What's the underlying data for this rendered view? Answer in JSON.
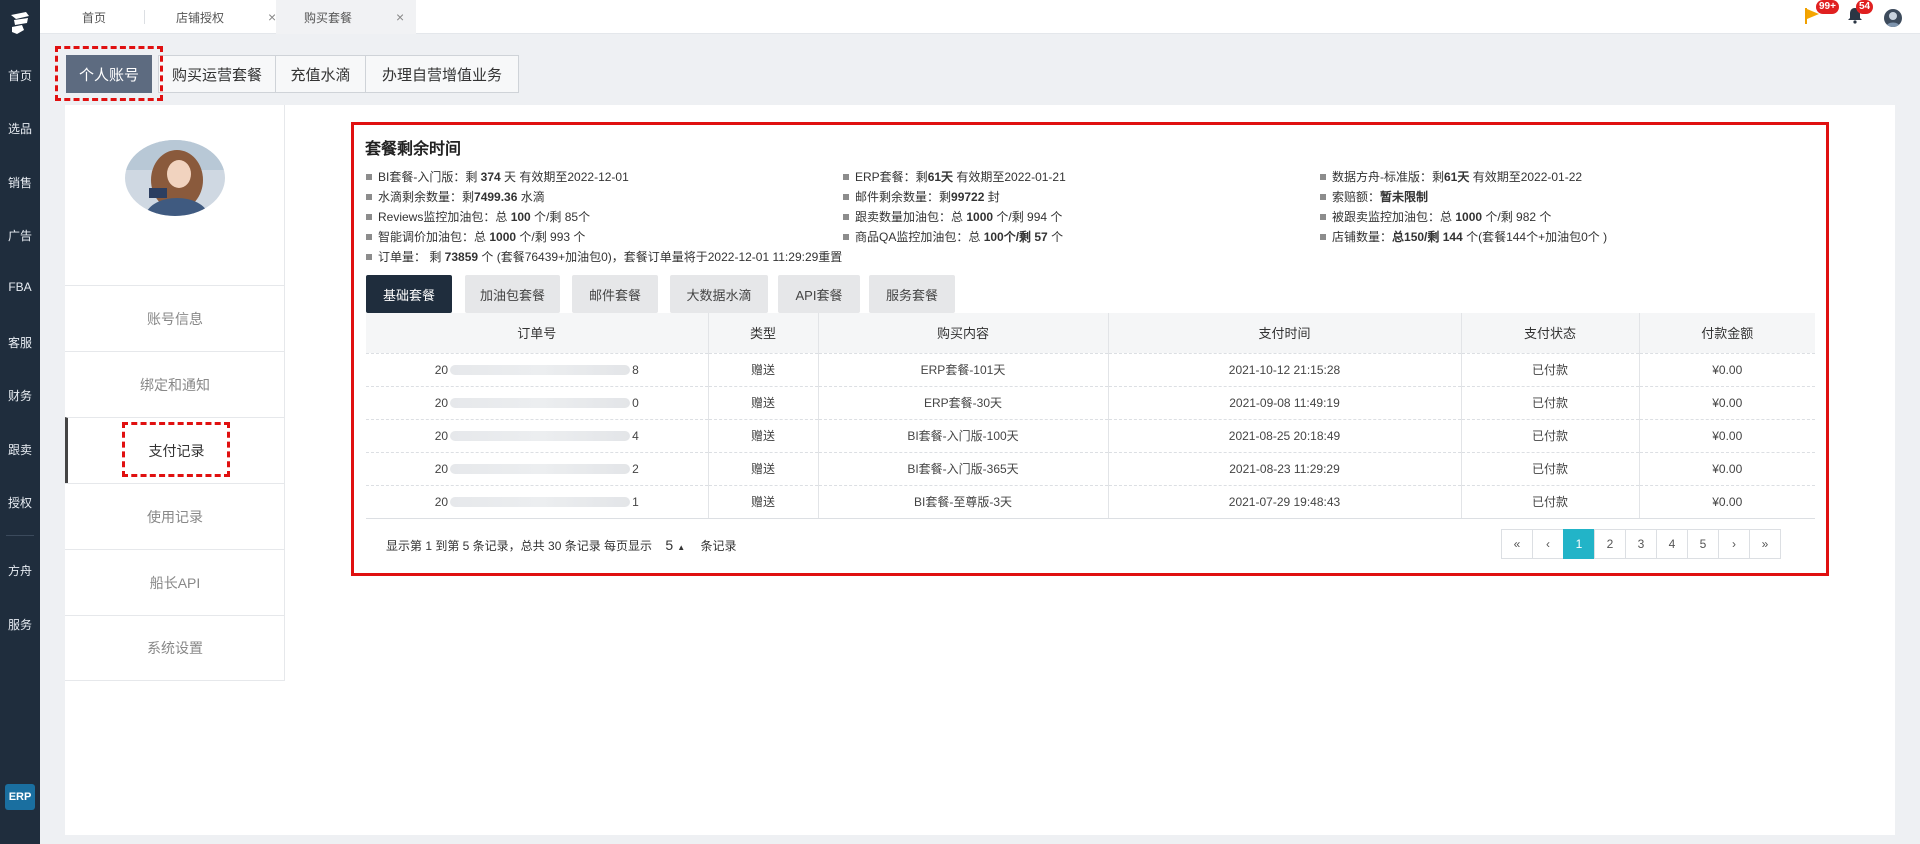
{
  "rail": {
    "items": [
      "首页",
      "选品",
      "销售",
      "广告",
      "FBA",
      "客服",
      "财务",
      "跟卖",
      "授权",
      "方舟",
      "服务"
    ],
    "bottom": "ERP"
  },
  "topbar": {
    "tabs": [
      {
        "label": "首页"
      },
      {
        "label": "店铺授权",
        "close": "×"
      },
      {
        "label": "购买套餐",
        "close": "×"
      }
    ],
    "flag_badge": "99+",
    "bell_badge": "54"
  },
  "section_tabs": [
    "个人账号",
    "购买运营套餐",
    "充值水滴",
    "办理自营增值业务"
  ],
  "left_menu": [
    "账号信息",
    "绑定和通知",
    "支付记录",
    "使用记录",
    "船长API",
    "系统设置"
  ],
  "main": {
    "title": "套餐剩余时间",
    "info": [
      [
        "BI套餐-入门版：剩 ",
        "374",
        " 天 有效期至2022-12-01"
      ],
      [
        "ERP套餐：剩",
        "61天",
        " 有效期至2022-01-21"
      ],
      [
        "数据方舟-标准版：剩",
        "61天",
        " 有效期至2022-01-22"
      ],
      [
        "水滴剩余数量：剩",
        "7499.36",
        " 水滴"
      ],
      [
        "邮件剩余数量：剩",
        "99722",
        " 封"
      ],
      [
        "索赔额：",
        "暂未限制",
        ""
      ],
      [
        "Reviews监控加油包：总 ",
        "100",
        " 个/剩 85个"
      ],
      [
        "跟卖数量加油包：总 ",
        "1000",
        " 个/剩 994 个"
      ],
      [
        "被跟卖监控加油包：总 ",
        "1000",
        " 个/剩 982 个"
      ],
      [
        "智能调价加油包：总 ",
        "1000",
        " 个/剩 993 个"
      ],
      [
        "商品QA监控加油包：总 ",
        "100个/剩 57",
        " 个"
      ],
      [
        "店铺数量：",
        "总150/剩 144",
        " 个(套餐144个+加油包0个 )"
      ],
      [
        "订单量：  剩 ",
        "73859",
        " 个 (套餐76439+加油包0)，套餐订单量将于2022-12-01 11:29:29重置"
      ]
    ]
  },
  "content_tabs": [
    "基础套餐",
    "加油包套餐",
    "邮件套餐",
    "大数据水滴",
    "API套餐",
    "服务套餐"
  ],
  "table": {
    "headers": [
      "订单号",
      "类型",
      "购买内容",
      "支付时间",
      "支付状态",
      "付款金额"
    ],
    "rows": [
      {
        "id_prefix": "20",
        "id_suffix": "8",
        "type": "赠送",
        "content": "ERP套餐-101天",
        "time": "2021-10-12 21:15:28",
        "status": "已付款",
        "amount": "¥0.00"
      },
      {
        "id_prefix": "20",
        "id_suffix": "0",
        "type": "赠送",
        "content": "ERP套餐-30天",
        "time": "2021-09-08 11:49:19",
        "status": "已付款",
        "amount": "¥0.00"
      },
      {
        "id_prefix": "20",
        "id_suffix": "4",
        "type": "赠送",
        "content": "BI套餐-入门版-100天",
        "time": "2021-08-25 20:18:49",
        "status": "已付款",
        "amount": "¥0.00"
      },
      {
        "id_prefix": "20",
        "id_suffix": "2",
        "type": "赠送",
        "content": "BI套餐-入门版-365天",
        "time": "2021-08-23 11:29:29",
        "status": "已付款",
        "amount": "¥0.00"
      },
      {
        "id_prefix": "20",
        "id_suffix": "1",
        "type": "赠送",
        "content": "BI套餐-至尊版-3天",
        "time": "2021-07-29 19:48:43",
        "status": "已付款",
        "amount": "¥0.00"
      }
    ]
  },
  "footer": {
    "summary": "显示第 1 到第 5 条记录，总共 30 条记录 每页显示",
    "page_size": "5",
    "page_size_caret": "▲",
    "suffix": "条记录"
  },
  "pager": [
    "«",
    "‹",
    "1",
    "2",
    "3",
    "4",
    "5",
    "›",
    "»"
  ],
  "colors": {
    "accent": "#22b4c8",
    "rail": "#1f2d3d",
    "highlight": "#e01010"
  }
}
